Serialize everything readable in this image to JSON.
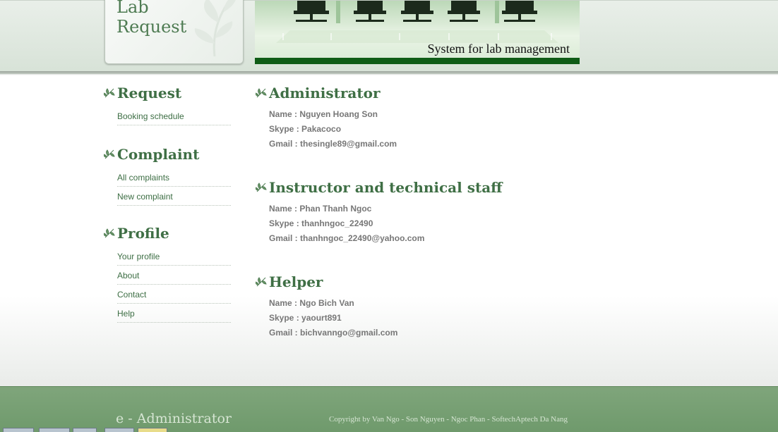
{
  "logo": {
    "title": "Lab\nRequest"
  },
  "banner": {
    "tagline": "System for lab management"
  },
  "sidebar": {
    "sections": [
      {
        "title": "Request",
        "items": [
          "Booking schedule"
        ]
      },
      {
        "title": "Complaint",
        "items": [
          "All complaints",
          "New complaint"
        ]
      },
      {
        "title": "Profile",
        "items": [
          "Your profile",
          "About",
          "Contact",
          "Help"
        ]
      }
    ]
  },
  "contacts": [
    {
      "title": "Administrator",
      "name": "Name : Nguyen Hoang Son",
      "skype": "Skype : Pakacoco",
      "gmail": "Gmail : thesingle89@gmail.com"
    },
    {
      "title": "Instructor and technical staff",
      "name": "Name : Phan Thanh Ngoc",
      "skype": "Skype : thanhngoc_22490",
      "gmail": "Gmail : thanhngoc_22490@yahoo.com"
    },
    {
      "title": "Helper",
      "name": "Name : Ngo Bich Van",
      "skype": "Skype : yaourt891",
      "gmail": "Gmail : bichvanngo@gmail.com"
    }
  ],
  "footer": {
    "brand": "e - Administrator",
    "copyright": "Copyright by Van Ngo - Son Nguyen - Ngoc Phan - SoftechAptech Da Nang"
  },
  "colors": {
    "accent": "#3f6f45",
    "footer_bg": "#7fa57b",
    "banner_bar": "#0f5c16"
  }
}
